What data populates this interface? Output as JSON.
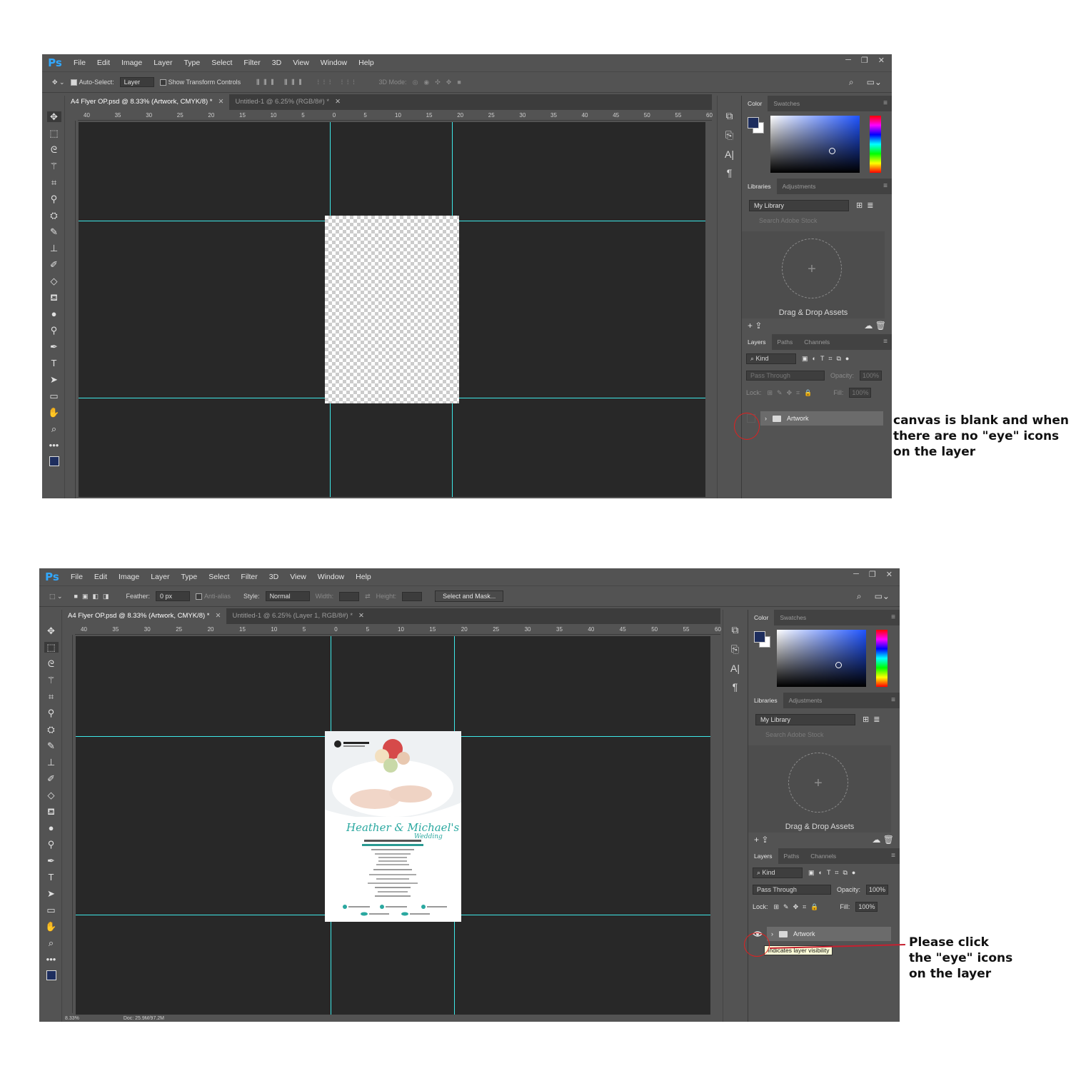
{
  "menu": [
    "File",
    "Edit",
    "Image",
    "Layer",
    "Type",
    "Select",
    "Filter",
    "3D",
    "View",
    "Window",
    "Help"
  ],
  "ps_logo": "Ps",
  "window_controls": [
    "─",
    "❐",
    "✕"
  ],
  "top": {
    "options": {
      "auto_select_label": "Auto-Select:",
      "auto_select_value": "Layer",
      "show_transform_label": "Show Transform Controls",
      "mode_3d_label": "3D Mode:"
    },
    "tabs": [
      {
        "label": "A4 Flyer OP.psd @ 8.33% (Artwork, CMYK/8) *",
        "close": "✕"
      },
      {
        "label": "Untitled-1 @ 6.25% (RGB/8#) *",
        "close": "✕"
      }
    ],
    "layer_name": "Artwork",
    "opacity": "100%",
    "fill": "100%",
    "blend_mode": "Pass Through"
  },
  "bottom": {
    "options": {
      "feather_label": "Feather:",
      "feather_value": "0 px",
      "anti_alias_label": "Anti-alias",
      "style_label": "Style:",
      "style_value": "Normal",
      "width_label": "Width:",
      "height_label": "Height:",
      "select_mask_label": "Select and Mask..."
    },
    "tabs": [
      {
        "label": "A4 Flyer OP.psd @ 8.33% (Artwork, CMYK/8) *",
        "close": "✕"
      },
      {
        "label": "Untitled-1 @ 6.25% (Layer 1, RGB/8#) *",
        "close": "✕"
      }
    ],
    "layer_name": "Artwork",
    "opacity": "100%",
    "fill": "100%",
    "blend_mode": "Pass Through",
    "tooltip": "Indicates layer visibility",
    "status_zoom": "8.33%",
    "status_doc": "Doc: 25.9M/97.2M"
  },
  "ruler_ticks": [
    "40",
    "35",
    "30",
    "25",
    "20",
    "15",
    "10",
    "5",
    "0",
    "5",
    "10",
    "15",
    "20",
    "25",
    "30",
    "35",
    "40",
    "45",
    "50",
    "55",
    "60"
  ],
  "panels": {
    "color_tab": "Color",
    "swatches_tab": "Swatches",
    "libraries_tab": "Libraries",
    "adjustments_tab": "Adjustments",
    "library_select": "My Library",
    "search_placeholder": "Search Adobe Stock",
    "drag_drop": "Drag & Drop Assets",
    "layers_tab": "Layers",
    "paths_tab": "Paths",
    "channels_tab": "Channels",
    "kind_label": "Kind",
    "opacity_label": "Opacity:",
    "lock_label": "Lock:",
    "fill_label": "Fill:",
    "colors": {
      "foreground": "#1d2d5d",
      "background": "#ffffff"
    }
  },
  "annotations": {
    "top": [
      "canvas is blank and when",
      "there are no \"eye\" icons",
      "on the layer"
    ],
    "bottom": [
      "Please click",
      "the \"eye\" icons",
      "on the layer"
    ]
  },
  "accent_colors": {
    "guides": "#3ee8e8",
    "annotation_red": "#e02020",
    "ps_blue": "#31a8ff"
  }
}
